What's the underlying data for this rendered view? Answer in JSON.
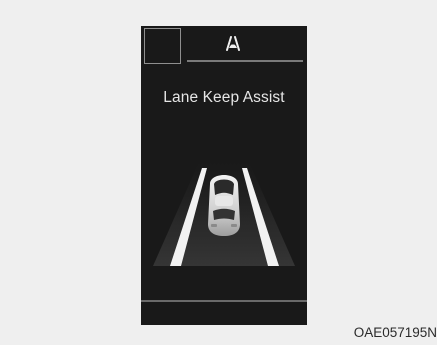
{
  "cluster_display": {
    "title": "Lane Keep Assist",
    "indicator_icon": "lane-keep-assist-icon",
    "graphic": "car-between-lane-lines"
  },
  "image_code": "OAE057195N",
  "colors": {
    "screen_background": "#191919",
    "page_background": "#efefef",
    "text": "#e6e6e6",
    "lane_line": "#f2f2f2"
  }
}
